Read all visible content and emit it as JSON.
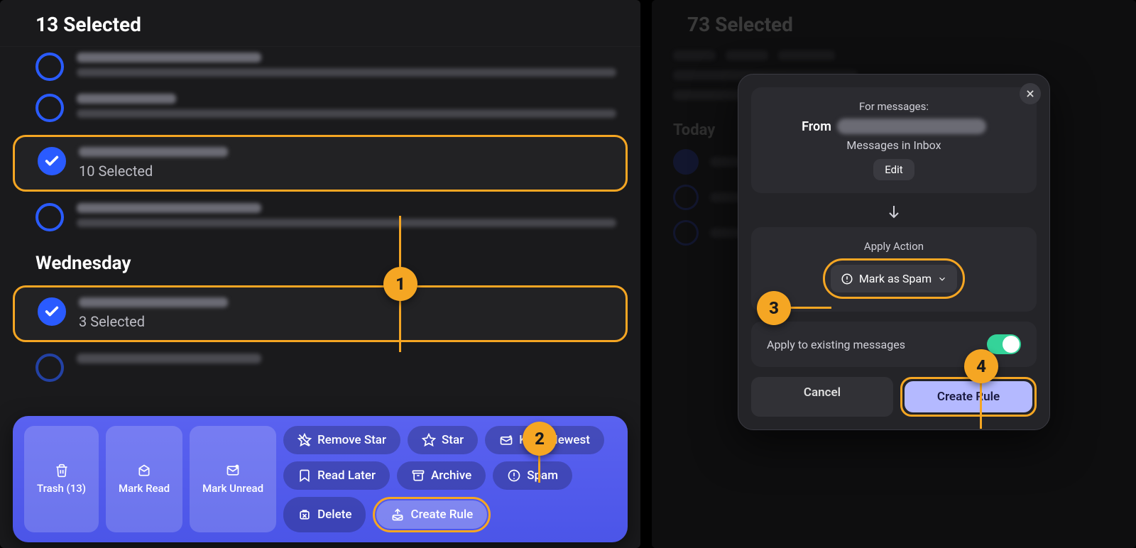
{
  "left": {
    "title": "13 Selected",
    "groups": [
      {
        "selected_count": "10 Selected"
      },
      {
        "selected_count": "3 Selected"
      }
    ],
    "section_header": "Wednesday",
    "toolbar": {
      "trash": "Trash (13)",
      "mark_read": "Mark Read",
      "mark_unread": "Mark Unread",
      "remove_star": "Remove Star",
      "star": "Star",
      "keep_newest": "Keep Newest",
      "read_later": "Read Later",
      "archive": "Archive",
      "spam": "Spam",
      "delete": "Delete",
      "create_rule": "Create Rule"
    }
  },
  "right": {
    "title": "73 Selected",
    "bg_section": "Today",
    "modal": {
      "for_messages": "For messages:",
      "from_label": "From",
      "messages_in": "Messages in Inbox",
      "edit": "Edit",
      "apply_action": "Apply Action",
      "action": "Mark as Spam",
      "apply_existing": "Apply to existing messages",
      "apply_existing_on": true,
      "cancel": "Cancel",
      "create_rule": "Create Rule"
    }
  },
  "callouts": {
    "one": "1",
    "two": "2",
    "three": "3",
    "four": "4"
  }
}
